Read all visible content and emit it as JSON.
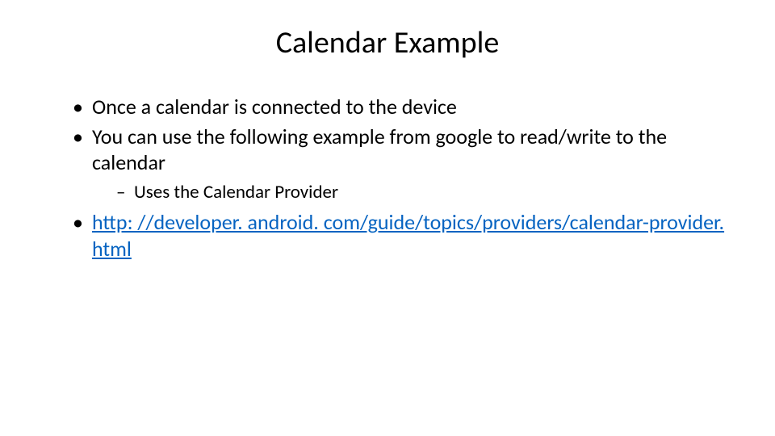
{
  "title": "Calendar Example",
  "bullets": {
    "b1": "Once a calendar is connected to the device",
    "b2": "You can use the following example from google to read/write to the calendar",
    "b2_sub1": "Uses the Calendar Provider",
    "b3_link": "http: //developer. android. com/guide/topics/providers/calendar-provider. html"
  }
}
